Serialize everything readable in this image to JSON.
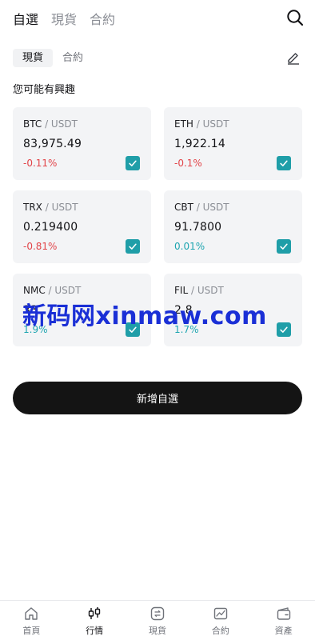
{
  "header": {
    "tabs": [
      {
        "label": "自選",
        "active": true
      },
      {
        "label": "現貨",
        "active": false
      },
      {
        "label": "合約",
        "active": false
      }
    ],
    "search_icon": "search-icon"
  },
  "segment": {
    "items": [
      {
        "label": "現貨",
        "active": true
      },
      {
        "label": "合約",
        "active": false
      }
    ],
    "edit_icon": "edit-icon"
  },
  "section_title": "您可能有興趣",
  "cards": [
    {
      "base": "BTC",
      "quote": " / USDT",
      "price": "83,975.49",
      "change": "-0.11%",
      "direction": "down",
      "checked": true
    },
    {
      "base": "ETH",
      "quote": " / USDT",
      "price": "1,922.14",
      "change": "-0.1%",
      "direction": "down",
      "checked": true
    },
    {
      "base": "TRX",
      "quote": " / USDT",
      "price": "0.219400",
      "change": "-0.81%",
      "direction": "down",
      "checked": true
    },
    {
      "base": "CBT",
      "quote": " / USDT",
      "price": "91.7800",
      "change": "0.01%",
      "direction": "up",
      "checked": true
    },
    {
      "base": "NMC",
      "quote": " / USDT",
      "price": "33",
      "change": "1.9%",
      "direction": "up",
      "checked": true
    },
    {
      "base": "FIL",
      "quote": " / USDT",
      "price": "2.8",
      "change": "1.7%",
      "direction": "up",
      "checked": true
    }
  ],
  "cta_label": "新增自選",
  "watermark": "新码网xinmaw.com",
  "tabbar": [
    {
      "label": "首頁",
      "icon": "home-icon",
      "active": false
    },
    {
      "label": "行情",
      "icon": "candlestick-icon",
      "active": true
    },
    {
      "label": "現貨",
      "icon": "swap-icon",
      "active": false
    },
    {
      "label": "合約",
      "icon": "contract-chart-icon",
      "active": false
    },
    {
      "label": "資產",
      "icon": "wallet-icon",
      "active": false
    }
  ],
  "colors": {
    "down": "#e2454a",
    "up": "#1ea5b0",
    "check": "#1f9ea8",
    "card_bg": "#f3f4f6",
    "cta_bg": "#141414"
  }
}
